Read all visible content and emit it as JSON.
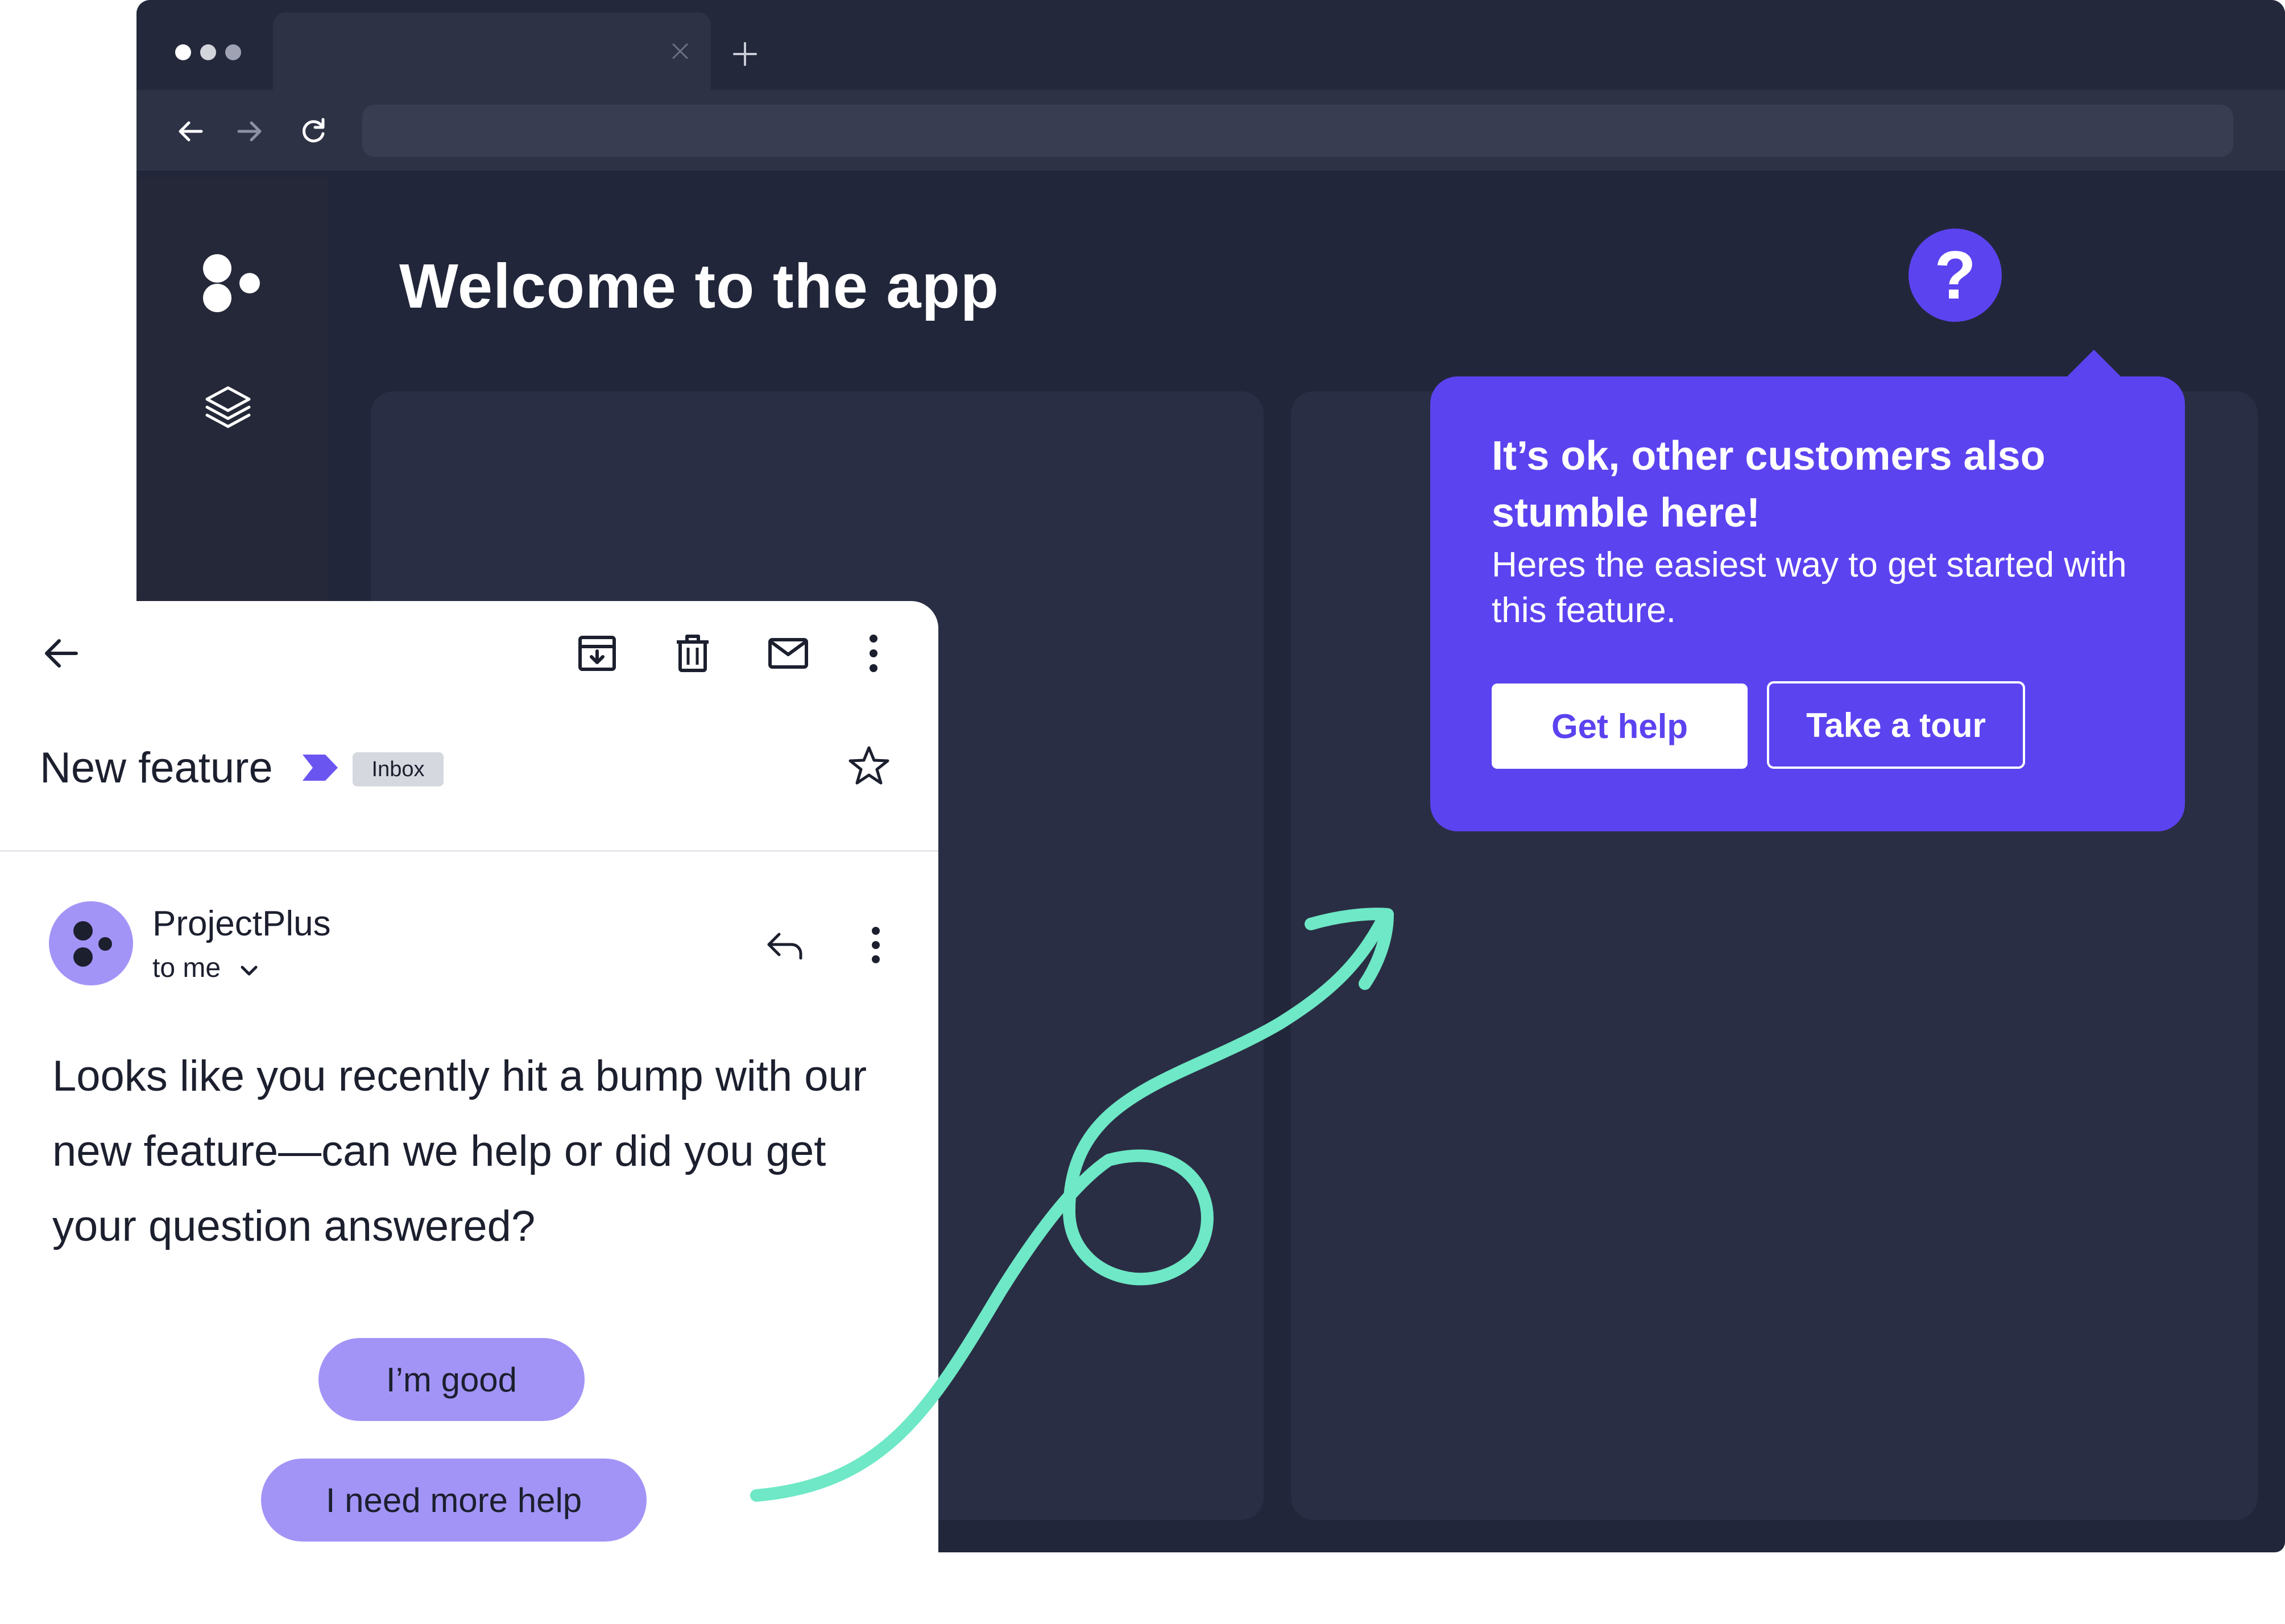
{
  "app": {
    "page_title": "Welcome to the app",
    "help_button_label": "?"
  },
  "popover": {
    "title": "It’s ok, other customers also stumble here!",
    "description": "Heres the easiest way to get started with this feature.",
    "primary_button": "Get help",
    "secondary_button": "Take a tour"
  },
  "email": {
    "subject": "New feature",
    "label": "Inbox",
    "sender": "ProjectPlus",
    "recipient": "to me",
    "body": "Looks like you recently hit a bump with our new feature—can we help or did you get your question answered?",
    "responses": [
      "I’m good",
      "I need more help"
    ]
  },
  "icons": {
    "toolbar": [
      "back-arrow-icon",
      "archive-icon",
      "trash-icon",
      "mail-icon",
      "more-vertical-icon"
    ],
    "browser": [
      "back-icon",
      "forward-icon",
      "reload-icon",
      "close-tab-icon",
      "new-tab-icon"
    ],
    "sidebar": [
      "logo-icon",
      "layers-icon"
    ]
  },
  "colors": {
    "accent_purple": "#5b43f0",
    "pill_purple": "#a294f6",
    "app_dark": "#22263a",
    "arrow_green": "#6ee8c6"
  }
}
